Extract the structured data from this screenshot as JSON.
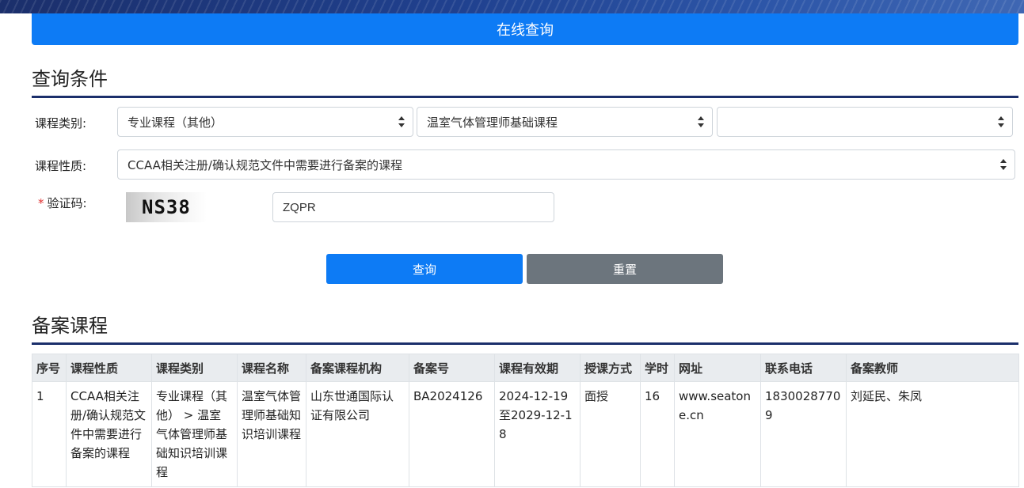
{
  "header": {
    "online_query": "在线查询"
  },
  "query_section": {
    "title": "查询条件",
    "course_category_label": "课程类别:",
    "course_category_values": [
      "专业课程（其他）",
      "温室气体管理师基础课程",
      ""
    ],
    "course_nature_label": "课程性质:",
    "course_nature_value": "CCAA相关注册/确认规范文件中需要进行备案的课程",
    "captcha_required_mark": "*",
    "captcha_label": "验证码:",
    "captcha_image_text": "NS38",
    "captcha_input_value": "ZQPR",
    "query_button": "查询",
    "reset_button": "重置"
  },
  "records_section": {
    "title": "备案课程",
    "columns": [
      "序号",
      "课程性质",
      "课程类别",
      "课程名称",
      "备案课程机构",
      "备案号",
      "课程有效期",
      "授课方式",
      "学时",
      "网址",
      "联系电话",
      "备案教师"
    ],
    "rows": [
      [
        "1",
        "CCAA相关注册/确认规范文件中需要进行备案的课程",
        "专业课程（其他） > 温室气体管理师基础知识培训课程",
        "温室气体管理师基础知识培训课程",
        "山东世通国际认证有限公司",
        "BA2024126",
        "2024-12-19至2029-12-18",
        "面授",
        "16",
        "www.seatone.cn",
        "18300287709",
        "刘延民、朱凤"
      ]
    ]
  },
  "colors": {
    "primary": "#0d7bf5",
    "secondary": "#6c757d",
    "rule": "#1b2f6b"
  }
}
